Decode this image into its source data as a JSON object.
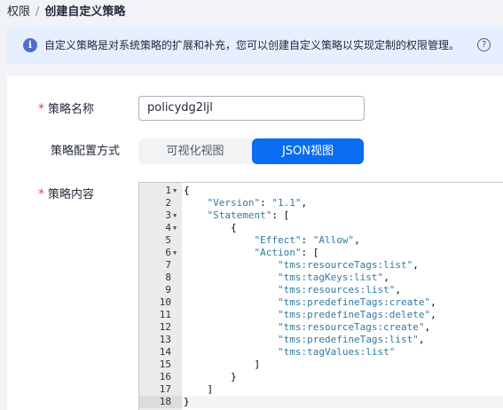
{
  "breadcrumb": {
    "parent": "权限",
    "separator": "/",
    "current": "创建自定义策略"
  },
  "banner": {
    "text": "自定义策略是对系统策略的扩展和补充，您可以创建自定义策略以实现定制的权限管理。",
    "info_icon": "info-icon",
    "help_icon": "help-icon"
  },
  "form": {
    "required_mark": "*",
    "name_label": "策略名称",
    "name_value": "policydg2ljl",
    "mode_label": "策略配置方式",
    "mode_visual": "可视化视图",
    "mode_json": "JSON视图",
    "mode_selected": "JSON视图",
    "content_label": "策略内容"
  },
  "editor": {
    "lines": [
      {
        "n": "1",
        "fold": true,
        "code": "{"
      },
      {
        "n": "2",
        "fold": false,
        "code": "    \"Version\": \"1.1\","
      },
      {
        "n": "3",
        "fold": true,
        "code": "    \"Statement\": ["
      },
      {
        "n": "4",
        "fold": true,
        "code": "        {"
      },
      {
        "n": "5",
        "fold": false,
        "code": "            \"Effect\": \"Allow\","
      },
      {
        "n": "6",
        "fold": true,
        "code": "            \"Action\": ["
      },
      {
        "n": "7",
        "fold": false,
        "code": "                \"tms:resourceTags:list\","
      },
      {
        "n": "8",
        "fold": false,
        "code": "                \"tms:tagKeys:list\","
      },
      {
        "n": "9",
        "fold": false,
        "code": "                \"tms:resources:list\","
      },
      {
        "n": "10",
        "fold": false,
        "code": "                \"tms:predefineTags:create\","
      },
      {
        "n": "11",
        "fold": false,
        "code": "                \"tms:predefineTags:delete\","
      },
      {
        "n": "12",
        "fold": false,
        "code": "                \"tms:resourceTags:create\","
      },
      {
        "n": "13",
        "fold": false,
        "code": "                \"tms:predefineTags:list\","
      },
      {
        "n": "14",
        "fold": false,
        "code": "                \"tms:tagValues:list\""
      },
      {
        "n": "15",
        "fold": false,
        "code": "            ]"
      },
      {
        "n": "16",
        "fold": false,
        "code": "        }"
      },
      {
        "n": "17",
        "fold": false,
        "code": "    ]"
      },
      {
        "n": "18",
        "fold": false,
        "code": "}"
      }
    ],
    "active_line": "18"
  }
}
